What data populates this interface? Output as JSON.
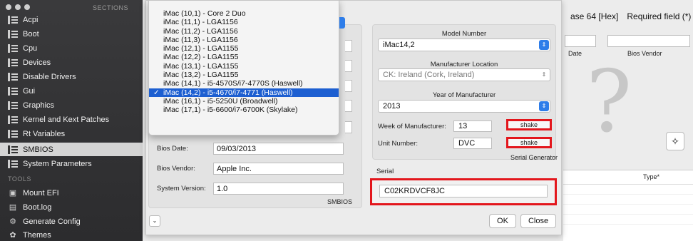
{
  "sidebar": {
    "sections_label": "SECTIONS",
    "items": [
      {
        "label": "Acpi"
      },
      {
        "label": "Boot"
      },
      {
        "label": "Cpu"
      },
      {
        "label": "Devices"
      },
      {
        "label": "Disable Drivers"
      },
      {
        "label": "Gui"
      },
      {
        "label": "Graphics"
      },
      {
        "label": "Kernel and Kext Patches"
      },
      {
        "label": "Rt Variables"
      },
      {
        "label": "SMBIOS"
      },
      {
        "label": "System Parameters"
      }
    ],
    "active": "SMBIOS",
    "tools_label": "TOOLS",
    "tools": [
      {
        "label": "Mount EFI",
        "icon": "disk-icon"
      },
      {
        "label": "Boot.log",
        "icon": "document-icon"
      },
      {
        "label": "Generate Config",
        "icon": "gear-icon"
      },
      {
        "label": "Themes",
        "icon": "palette-icon"
      }
    ]
  },
  "background": {
    "header_left": "ase 64 [Hex]",
    "header_right": "Required field (*)",
    "col1": "Date",
    "col2": "Bios Vendor",
    "table_header": "Type*"
  },
  "menu": {
    "items": [
      "iMac (10,1) - Core 2 Duo",
      "iMac (11,1) - LGA1156",
      "iMac (11,2) - LGA1156",
      "iMac (11,3) - LGA1156",
      "iMac (12,1) - LGA1155",
      "iMac (12,2) - LGA1155",
      "iMac (13,1) - LGA1155",
      "iMac (13,2) - LGA1155",
      "iMac (14,1) - i5-4570S/i7-4770S (Haswell)",
      "iMac (14,2) - i5-4670/i7-4771 (Haswell)",
      "iMac (16,1) - i5-5250U (Broadwell)",
      "iMac (17,1) - i5-6600/i7-6700K (Skylake)"
    ],
    "selected_index": 9,
    "check_mark": "✓"
  },
  "left_panel": {
    "bios_date_label": "Bios Date:",
    "bios_date": "09/03/2013",
    "bios_vendor_label": "Bios Vendor:",
    "bios_vendor": "Apple Inc.",
    "system_version_label": "System Version:",
    "system_version": "1.0",
    "footer": "SMBIOS"
  },
  "right_panel": {
    "model_number_label": "Model Number",
    "model_number": "iMac14,2",
    "manufacturer_location_label": "Manufacturer Location",
    "manufacturer_location": "CK: Ireland (Cork, Ireland)",
    "year_label": "Year of Manufacturer",
    "year": "2013",
    "week_label": "Week of Manufacturer:",
    "week": "13",
    "unit_label": "Unit Number:",
    "unit": "DVC",
    "shake_label": "shake",
    "serial_generator_label": "Serial Generator"
  },
  "serial": {
    "label": "Serial",
    "value": "C02KRDVCF8JC"
  },
  "buttons": {
    "ok": "OK",
    "close": "Close"
  },
  "colors": {
    "highlight": "#e3161c",
    "selection": "#1d5fd1"
  }
}
